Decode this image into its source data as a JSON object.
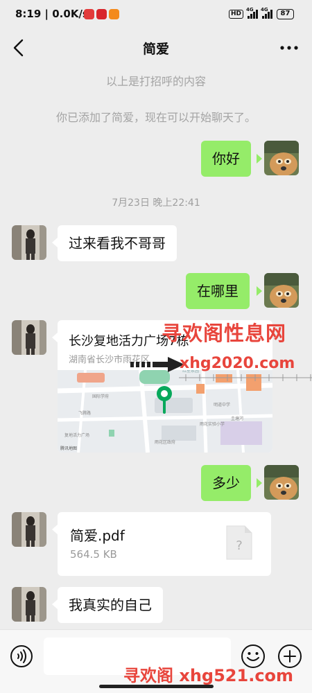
{
  "status_bar": {
    "time": "8:19",
    "speed": "0.0K/s",
    "hd": "HD",
    "net1": "4G",
    "net2": "4G",
    "battery": "87"
  },
  "nav": {
    "title": "简爱",
    "back_icon": "chevron-left-icon",
    "more_icon": "more-icon"
  },
  "messages": {
    "sys_greeting": "以上是打招呼的内容",
    "sys_added": "你已添加了简爱，现在可以开始聊天了。",
    "m1": "你好",
    "timestamp": "7月23日 晚上22:41",
    "m2": "过来看我不哥哥",
    "m3": "在哪里",
    "location": {
      "name": "长沙复地活力广场7栋",
      "address": "湖南省长沙市雨花区",
      "map_credit": "腾讯地图",
      "map_labels": [
        "红星家园",
        "国际学府",
        "明道中学",
        "飞腾路",
        "雨花实验小学",
        "复地活力广场",
        "圭塘河",
        "雨花区政府"
      ]
    },
    "m4": "多少",
    "file": {
      "name": "简爱.pdf",
      "size": "564.5 KB",
      "icon_text": "?"
    },
    "m5": "我真实的自己"
  },
  "watermarks": {
    "top": "寻欢阁性息网",
    "url": "xhg2020.com",
    "bottom": "寻欢阁 xhg521.com"
  },
  "colors": {
    "background": "#ededed",
    "outgoing_bubble": "#95ec69",
    "incoming_bubble": "#ffffff",
    "watermark": "#e8453c",
    "map_pin": "#07a85b"
  }
}
